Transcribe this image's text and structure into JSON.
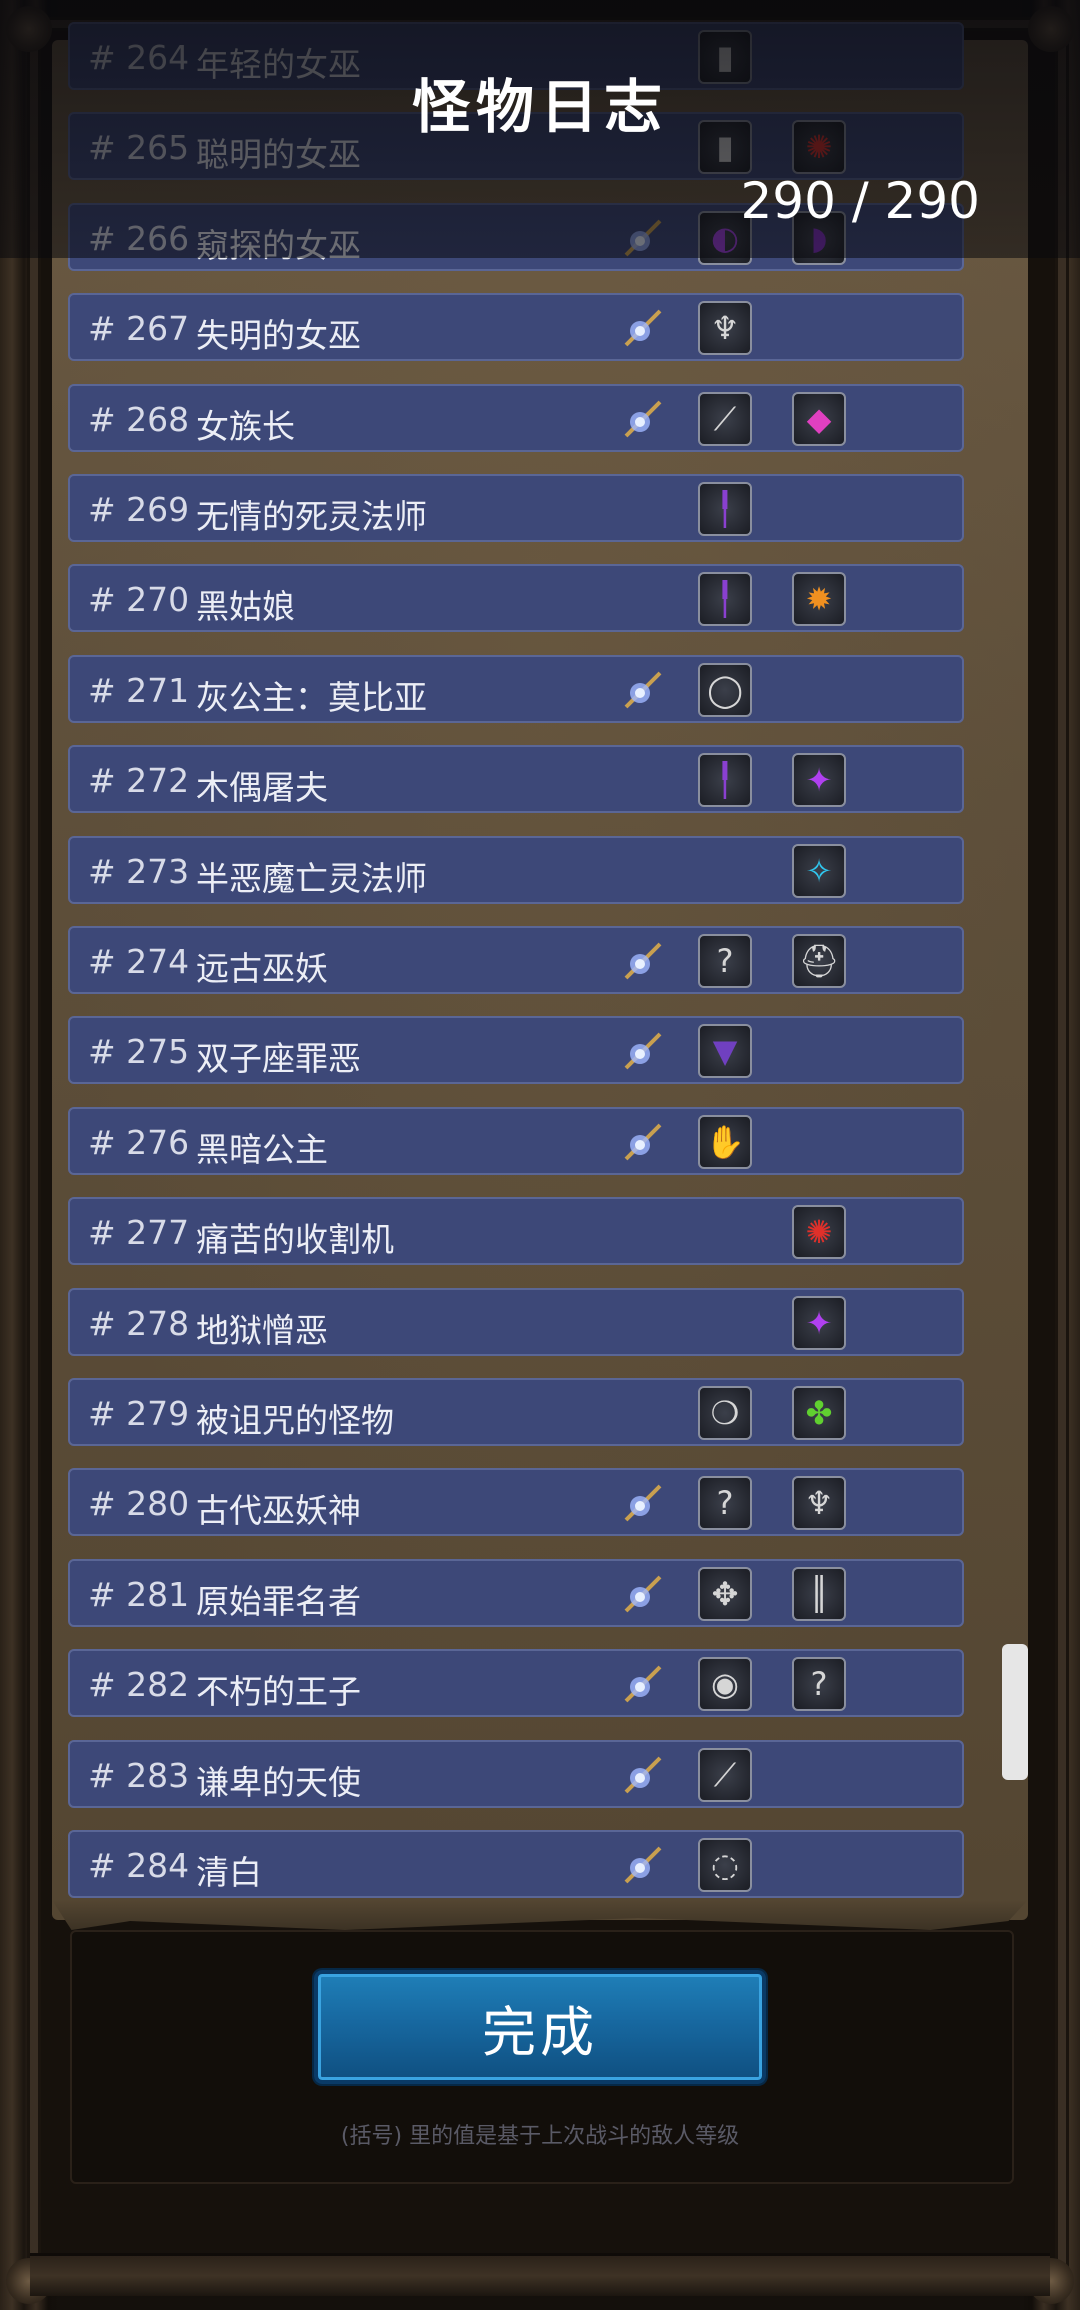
{
  "header": {
    "title": "怪物日志",
    "count": "290 / 290"
  },
  "rows": [
    {
      "num": "# 264",
      "name": "年轻的女巫",
      "mark": false,
      "slot1": "dark-item",
      "slot2": ""
    },
    {
      "num": "# 265",
      "name": "聪明的女巫",
      "mark": false,
      "slot1": "dark-item",
      "slot2": "red-rune"
    },
    {
      "num": "# 266",
      "name": "窥探的女巫",
      "mark": true,
      "slot1": "purple-bow",
      "slot2": "purple-item"
    },
    {
      "num": "# 267",
      "name": "失明的女巫",
      "mark": true,
      "slot1": "claw",
      "slot2": ""
    },
    {
      "num": "# 268",
      "name": "女族长",
      "mark": true,
      "slot1": "blade",
      "slot2": "pink-rune"
    },
    {
      "num": "# 269",
      "name": "无情的死灵法师",
      "mark": false,
      "slot1": "purple-staff",
      "slot2": ""
    },
    {
      "num": "# 270",
      "name": "黑姑娘",
      "mark": false,
      "slot1": "purple-staff",
      "slot2": "orange-rune"
    },
    {
      "num": "# 271",
      "name": "灰公主：莫比亚",
      "mark": true,
      "slot1": "ring",
      "slot2": ""
    },
    {
      "num": "# 272",
      "name": "木偶屠夫",
      "mark": false,
      "slot1": "purple-staff",
      "slot2": "purple-rune"
    },
    {
      "num": "# 273",
      "name": "半恶魔亡灵法师",
      "mark": false,
      "slot1": "",
      "slot2": "cyan-rune"
    },
    {
      "num": "# 274",
      "name": "远古巫妖",
      "mark": true,
      "slot1": "?",
      "slot2": "helmet"
    },
    {
      "num": "# 275",
      "name": "双子座罪恶",
      "mark": true,
      "slot1": "cloak",
      "slot2": ""
    },
    {
      "num": "# 276",
      "name": "黑暗公主",
      "mark": true,
      "slot1": "purple-glove",
      "slot2": ""
    },
    {
      "num": "# 277",
      "name": "痛苦的收割机",
      "mark": false,
      "slot1": "",
      "slot2": "red-rune"
    },
    {
      "num": "# 278",
      "name": "地狱憎恶",
      "mark": false,
      "slot1": "",
      "slot2": "purple-rune"
    },
    {
      "num": "# 279",
      "name": "被诅咒的怪物",
      "mark": false,
      "slot1": "amulet",
      "slot2": "green-rune"
    },
    {
      "num": "# 280",
      "name": "古代巫妖神",
      "mark": true,
      "slot1": "?",
      "slot2": "claw"
    },
    {
      "num": "# 281",
      "name": "原始罪名者",
      "mark": true,
      "slot1": "mace",
      "slot2": "greaves"
    },
    {
      "num": "# 282",
      "name": "不朽的王子",
      "mark": true,
      "slot1": "shield",
      "slot2": "?"
    },
    {
      "num": "# 283",
      "name": "谦卑的天使",
      "mark": true,
      "slot1": "scepter",
      "slot2": ""
    },
    {
      "num": "# 284",
      "name": "清白",
      "mark": true,
      "slot1": "necklace",
      "slot2": ""
    }
  ],
  "footer": {
    "done_label": "完成",
    "note": "(括号) 里的值是基于上次战斗的敌人等级"
  },
  "colors": {
    "row_bg": "#3d4878",
    "button": "#1768a0"
  }
}
